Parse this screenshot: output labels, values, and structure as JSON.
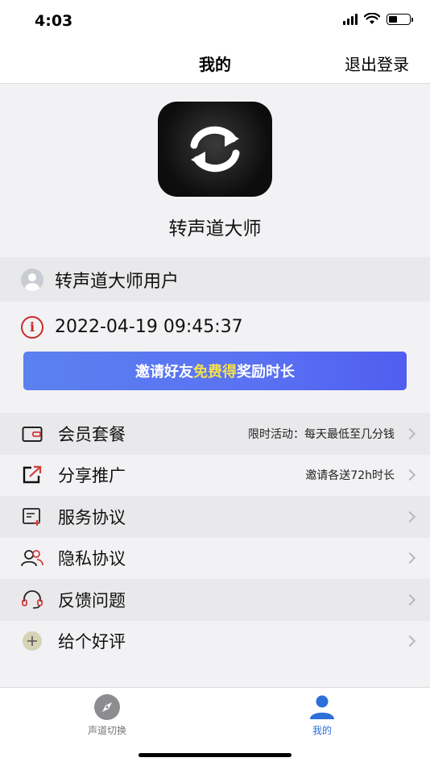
{
  "status_bar": {
    "time": "4:03"
  },
  "nav": {
    "title": "我的",
    "logout_label": "退出登录"
  },
  "app": {
    "name": "转声道大师"
  },
  "user": {
    "name": "转声道大师用户",
    "datetime": "2022-04-19 09:45:37"
  },
  "invite_banner": {
    "prefix": "邀请好友 ",
    "highlight": "免费得",
    "suffix": "奖励时长"
  },
  "menu": {
    "items": [
      {
        "label": "会员套餐",
        "note": "限时活动：每天最低至几分钱"
      },
      {
        "label": "分享推广",
        "note": "邀请各送72h时长"
      },
      {
        "label": "服务协议",
        "note": ""
      },
      {
        "label": "隐私协议",
        "note": ""
      },
      {
        "label": "反馈问题",
        "note": ""
      },
      {
        "label": "给个好评",
        "note": ""
      }
    ]
  },
  "tabs": [
    {
      "label": "声道切换",
      "icon": "compass-icon",
      "active": false
    },
    {
      "label": "我的",
      "icon": "person-icon",
      "active": true
    }
  ],
  "colors": {
    "accent": "#2c6fd8",
    "banner": "#5a72f2",
    "highlight": "#f6e24a",
    "info": "#cc2a2a"
  }
}
